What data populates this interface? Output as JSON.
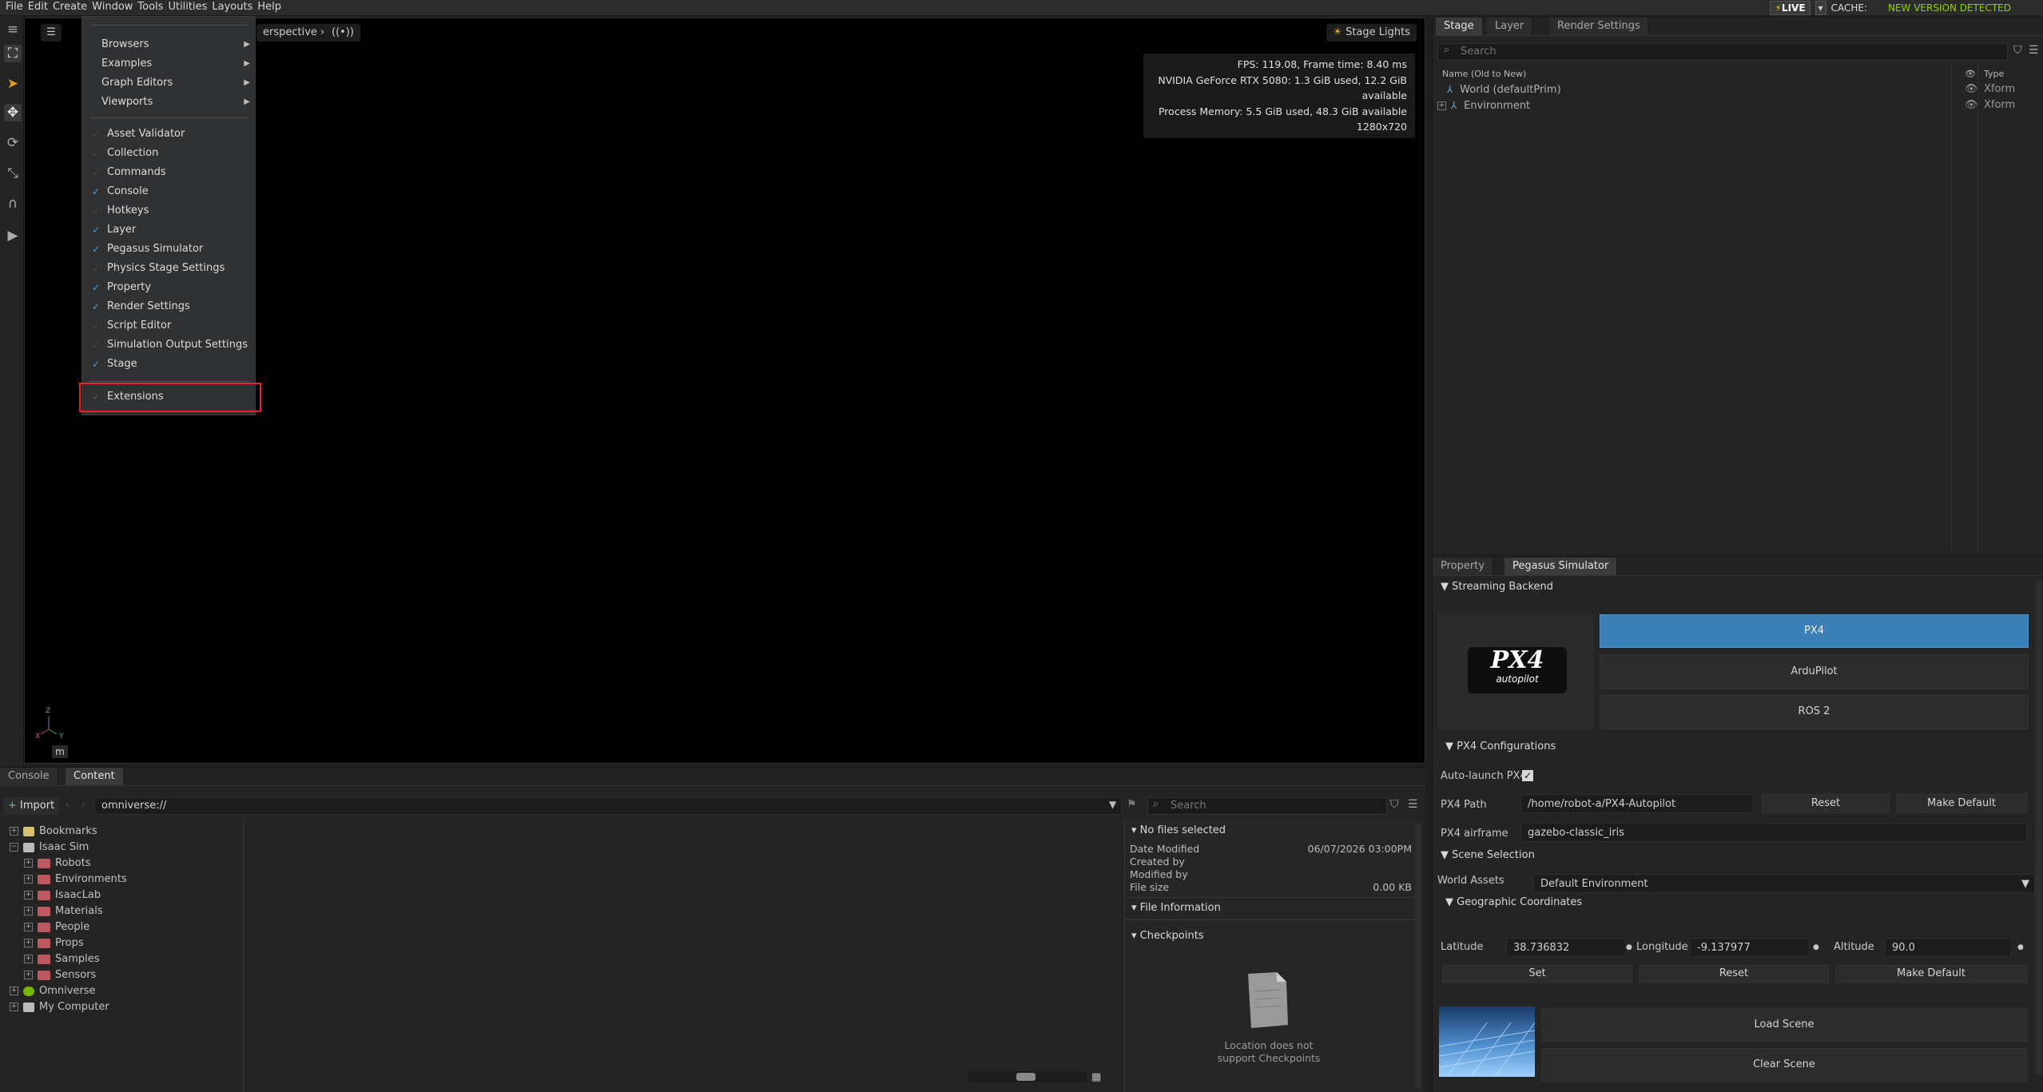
{
  "menubar": {
    "items": [
      "File",
      "Edit",
      "Create",
      "Window",
      "Tools",
      "Utilities",
      "Layouts",
      "Help"
    ],
    "live": "LIVE",
    "cache_label": "CACHE:",
    "new_version": "NEW VERSION DETECTED"
  },
  "viewport": {
    "camera_label": "Perspective",
    "camera_label_visible": "erspective",
    "stage_lights": "Stage Lights",
    "stats": [
      "FPS: 119.08, Frame time: 8.40 ms",
      "NVIDIA GeForce RTX 5080: 1.3 GiB used, 12.2 GiB available",
      "Process Memory: 5.5 GiB used, 48.3 GiB available",
      "1280x720"
    ],
    "units": "m",
    "axes": {
      "z": "Z",
      "x": "X",
      "y": "Y"
    }
  },
  "window_menu": {
    "submenus": [
      "Browsers",
      "Examples",
      "Graph Editors",
      "Viewports"
    ],
    "items": [
      {
        "label": "Asset Validator",
        "checked": false
      },
      {
        "label": "Collection",
        "checked": false
      },
      {
        "label": "Commands",
        "checked": false
      },
      {
        "label": "Console",
        "checked": true
      },
      {
        "label": "Hotkeys",
        "checked": false
      },
      {
        "label": "Layer",
        "checked": true
      },
      {
        "label": "Pegasus Simulator",
        "checked": true
      },
      {
        "label": "Physics Stage Settings",
        "checked": false
      },
      {
        "label": "Property",
        "checked": true
      },
      {
        "label": "Render Settings",
        "checked": true
      },
      {
        "label": "Script Editor",
        "checked": false
      },
      {
        "label": "Simulation Output Settings",
        "checked": false
      },
      {
        "label": "Stage",
        "checked": true
      }
    ],
    "extensions": "Extensions"
  },
  "stage_panel": {
    "tabs": [
      "Stage",
      "Layer",
      "Render Settings"
    ],
    "search_placeholder": "Search",
    "col_name": "Name (Old to New)",
    "col_type": "Type",
    "rows": [
      {
        "name": "World (defaultPrim)",
        "type": "Xform"
      },
      {
        "name": "Environment",
        "type": "Xform"
      }
    ]
  },
  "pegasus": {
    "tabs": [
      "Property",
      "Pegasus Simulator"
    ],
    "streaming_backend": "Streaming Backend",
    "logo_text": "PX4",
    "logo_sub": "autopilot",
    "backends": [
      "PX4",
      "ArduPilot",
      "ROS 2"
    ],
    "px4_config": "PX4 Configurations",
    "autolaunch_label": "Auto-launch PX4",
    "px4_path_label": "PX4 Path",
    "px4_path_value": "/home/robot-a/PX4-Autopilot",
    "reset": "Reset",
    "make_default": "Make Default",
    "airframe_label": "PX4 airframe",
    "airframe_value": "gazebo-classic_iris",
    "scene_selection": "Scene Selection",
    "world_assets_label": "World Assets",
    "world_assets_value": "Default Environment",
    "geo_coords": "Geographic Coordinates",
    "latitude_label": "Latitude",
    "latitude_value": "38.736832",
    "longitude_label": "Longitude",
    "longitude_value": "-9.137977",
    "altitude_label": "Altitude",
    "altitude_value": "90.0",
    "set": "Set",
    "load_scene": "Load Scene",
    "clear_scene": "Clear Scene"
  },
  "bottom": {
    "tabs": [
      "Console",
      "Content"
    ],
    "import": "Import",
    "path": "omniverse://",
    "search_placeholder": "Search",
    "tree": [
      {
        "label": "Bookmarks",
        "level": 0
      },
      {
        "label": "Isaac Sim",
        "level": 0
      },
      {
        "label": "Robots",
        "level": 1
      },
      {
        "label": "Environments",
        "level": 1
      },
      {
        "label": "IsaacLab",
        "level": 1
      },
      {
        "label": "Materials",
        "level": 1
      },
      {
        "label": "People",
        "level": 1
      },
      {
        "label": "Props",
        "level": 1
      },
      {
        "label": "Samples",
        "level": 1
      },
      {
        "label": "Sensors",
        "level": 1
      },
      {
        "label": "Omniverse",
        "level": 0
      },
      {
        "label": "My Computer",
        "level": 0
      }
    ],
    "no_files": "No files selected",
    "date_modified_label": "Date Modified",
    "date_modified_value": "06/07/2026 03:00PM",
    "created_by": "Created by",
    "modified_by": "Modified by",
    "file_size_label": "File size",
    "file_size_value": "0.00 KB",
    "file_information": "File Information",
    "checkpoints": "Checkpoints",
    "checkpoint_msg_1": "Location does not",
    "checkpoint_msg_2": "support Checkpoints"
  }
}
